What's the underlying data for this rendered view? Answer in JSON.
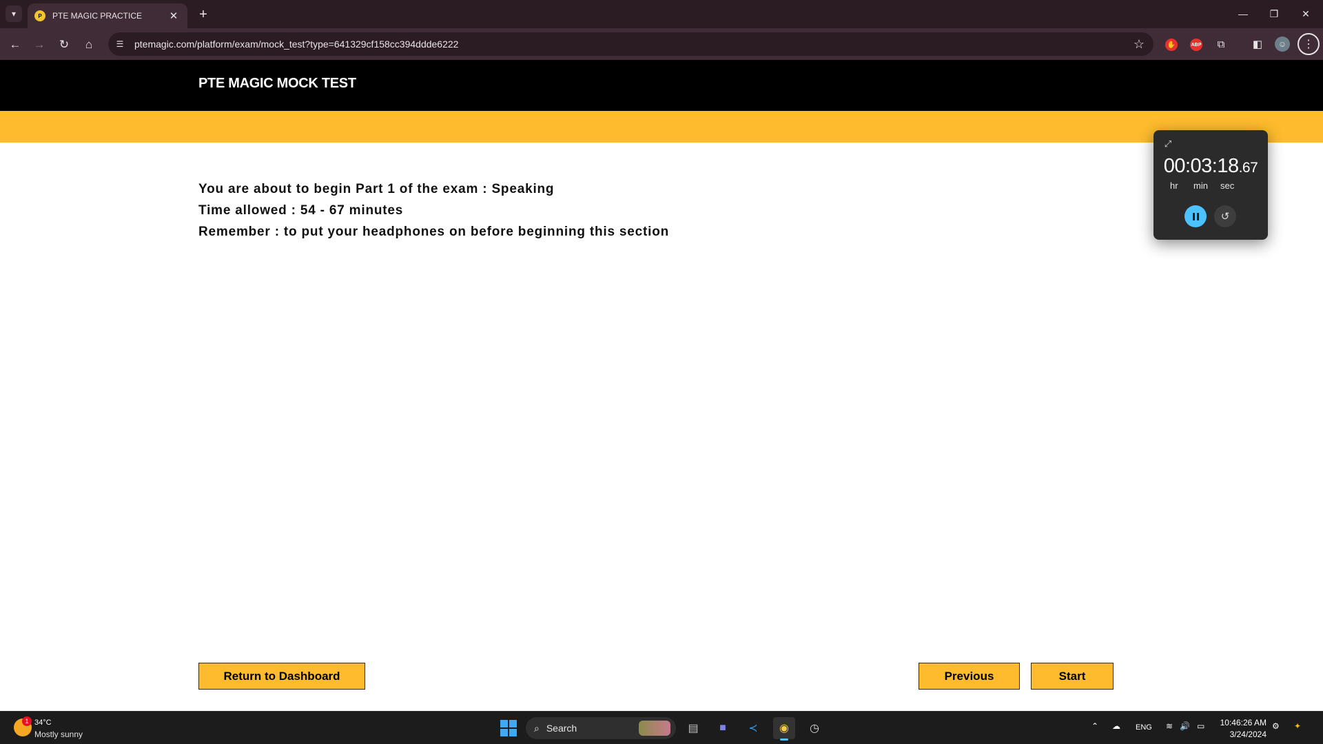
{
  "browser": {
    "tab_title": "PTE MAGIC PRACTICE",
    "tab_close": "✕",
    "new_tab": "+",
    "url": "ptemagic.com/platform/exam/mock_test?type=641329cf158cc394ddde6222",
    "window_controls": {
      "minimize": "—",
      "restore": "❐",
      "close": "✕"
    },
    "icons": {
      "tab_search": "chevron-down-icon",
      "back": "back-arrow-icon",
      "forward": "forward-arrow-icon",
      "reload": "reload-icon",
      "home": "home-icon",
      "site_info": "tune-icon",
      "bookmark": "star-icon",
      "extensions": [
        "hand-extension-icon",
        "adblock-icon",
        "puzzle-extensions-icon",
        "side-panel-icon",
        "profile-avatar-icon",
        "kebab-menu-icon"
      ]
    },
    "adblock_label": "ABP"
  },
  "site": {
    "brand": "PTE MAGIC MOCK TEST",
    "colors": {
      "header": "#000000",
      "accent": "#fdbb2d"
    }
  },
  "instructions": {
    "line1": "You are about to begin Part 1 of the exam : Speaking",
    "line2": "Time allowed : 54 - 67 minutes",
    "line3": "Remember : to put your headphones on before beginning this section"
  },
  "buttons": {
    "return": "Return to Dashboard",
    "previous": "Previous",
    "start": "Start"
  },
  "stopwatch": {
    "time_main": "00:03:18",
    "time_fraction": ".67",
    "units": {
      "hr": "hr",
      "min": "min",
      "sec": "sec"
    },
    "icons": {
      "expand": "expand-icon",
      "pause": "pause-icon",
      "reset": "reset-icon"
    }
  },
  "taskbar": {
    "weather": {
      "temp": "34°C",
      "condition": "Mostly sunny",
      "badge": "1"
    },
    "search_placeholder": "Search",
    "apps": [
      "windows-start-icon",
      "file-explorer-icon",
      "teams-icon",
      "vscode-icon",
      "chrome-icon",
      "clock-app-icon"
    ],
    "language": "ENG",
    "time": "10:46:26 AM",
    "date": "3/24/2024"
  }
}
